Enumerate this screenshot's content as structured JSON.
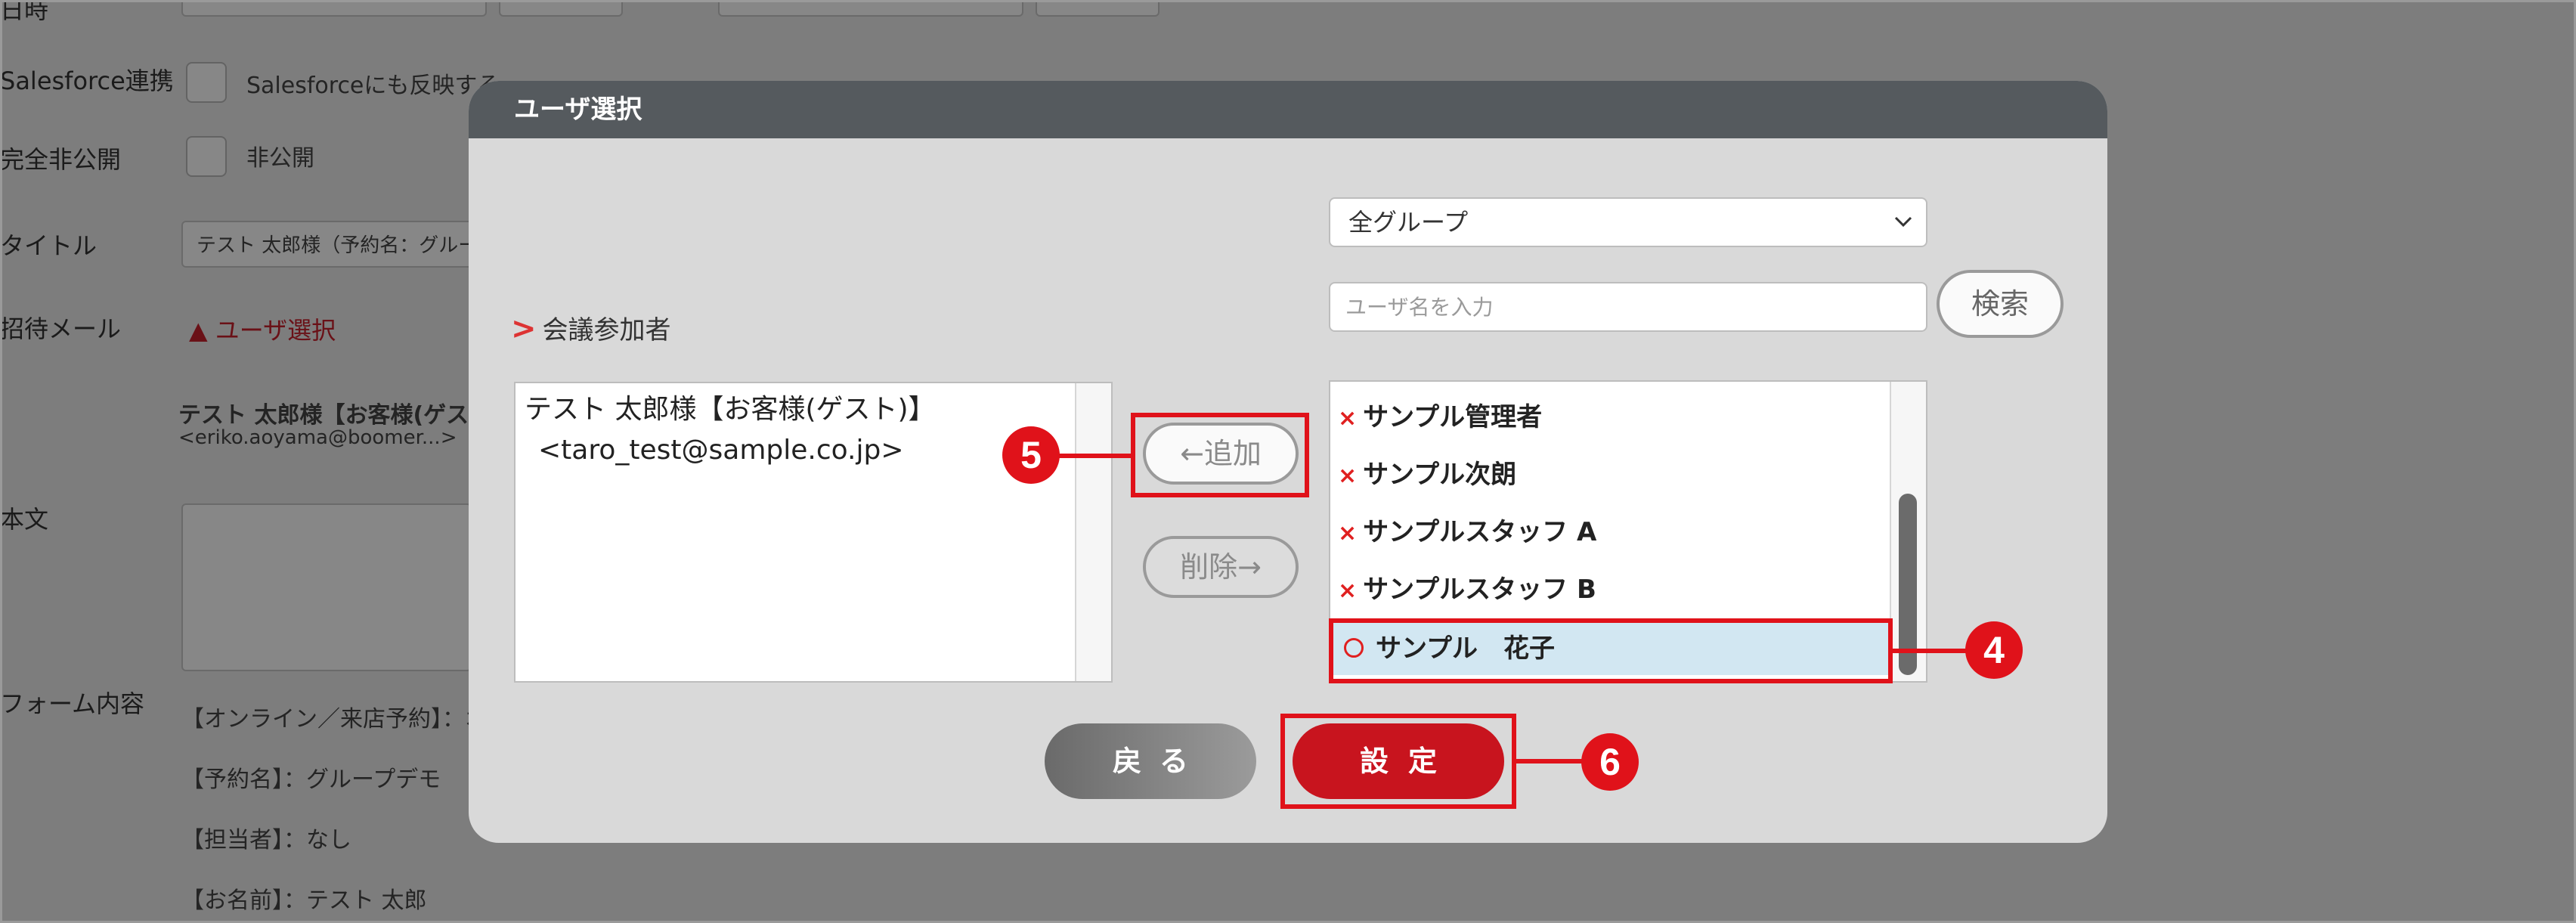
{
  "background": {
    "labels": [
      "日時",
      "Salesforce連携",
      "完全非公開",
      "タイトル",
      "招待メール",
      "本文",
      "フォーム内容"
    ],
    "salesforce_checkbox_label": "Salesforceにも反映する",
    "private_checkbox_label": "非公開",
    "title_value": "テスト 太郎様（予約名：グループデモ）",
    "user_select_link": "ユーザ選択",
    "invitee_name": "テスト 太郎様【お客様(ゲスト)】",
    "invitee_email": "<eriko.aoyama@boomer...>",
    "form_lines": [
      "【オンライン／来店予約】：オンライン",
      "【予約名】：グループデモ",
      "【担当者】：なし",
      "【お名前】：テスト 太郎"
    ]
  },
  "modal": {
    "title": "ユーザ選択",
    "participants_label": "会議参加者",
    "participants": [
      {
        "line1": "テスト 太郎様【お客様(ゲスト)】",
        "line2": "<taro_test@sample.co.jp>"
      }
    ],
    "add_button": "←追加",
    "remove_button": "削除→",
    "group_select": {
      "selected": "全グループ"
    },
    "search": {
      "placeholder": "ユーザ名を入力",
      "button": "検索"
    },
    "users": [
      {
        "name": "サンプル管理者",
        "mark": "×",
        "selected": false
      },
      {
        "name": "サンプル次朗",
        "mark": "×",
        "selected": false
      },
      {
        "name": "サンプルスタッフ A",
        "mark": "×",
        "selected": false
      },
      {
        "name": "サンプルスタッフ B",
        "mark": "×",
        "selected": false
      },
      {
        "name": "サンプル　花子",
        "mark": "○",
        "selected": true
      }
    ],
    "back_button": "戻る",
    "submit_button": "設定"
  },
  "callouts": {
    "four": "4",
    "five": "5",
    "six": "6"
  },
  "colors": {
    "accent_red": "#e0121a",
    "submit_red": "#c8141e",
    "header_gray": "#555a5e",
    "selected_row": "#d2e7f2"
  }
}
